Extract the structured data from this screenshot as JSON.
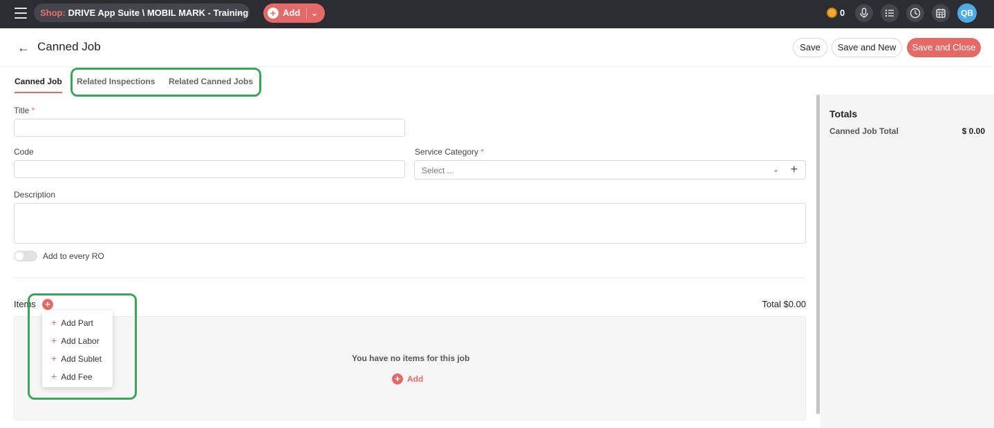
{
  "topbar": {
    "shop_label": "Shop:",
    "shop_name": "DRIVE App Suite \\ MOBIL MARK - Training",
    "add_label": "Add",
    "coin_count": "0",
    "avatar_initials": "QB"
  },
  "header": {
    "title": "Canned Job",
    "save_label": "Save",
    "save_new_label": "Save and New",
    "save_close_label": "Save and Close"
  },
  "tabs": [
    {
      "label": "Canned Job"
    },
    {
      "label": "Related Inspections"
    },
    {
      "label": "Related Canned Jobs"
    }
  ],
  "form": {
    "title_label": "Title",
    "code_label": "Code",
    "service_category_label": "Service Category",
    "service_category_placeholder": "Select ...",
    "description_label": "Description",
    "required_marker": "*",
    "add_every_ro_label": "Add to every RO"
  },
  "items": {
    "label": "Items",
    "total": "Total $0.00",
    "empty_message": "You have no items for this job",
    "empty_add": "Add",
    "menu": [
      "Add Part",
      "Add Labor",
      "Add Sublet",
      "Add Fee"
    ]
  },
  "totals": {
    "title": "Totals",
    "row_label": "Canned Job Total",
    "row_value": "$ 0.00"
  },
  "colors": {
    "accent": "#e36a67",
    "topbar": "#2b2d33",
    "highlight": "#3da35a"
  }
}
